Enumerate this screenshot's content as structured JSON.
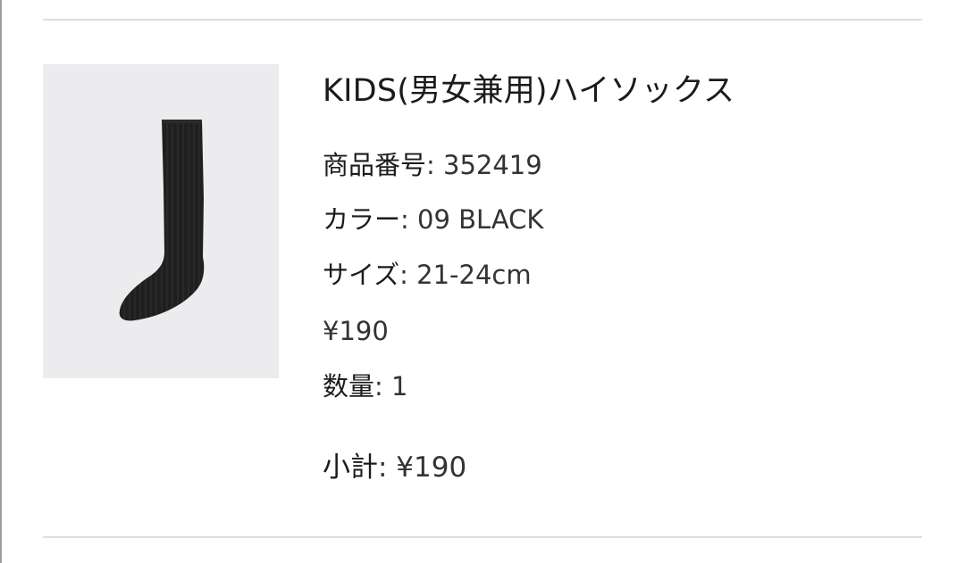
{
  "product": {
    "name": "KIDS(男女兼用)ハイソックス",
    "image_alt": "black high socks",
    "number_label": "商品番号",
    "number_value": ": 352419",
    "color_label": "カラー",
    "color_value": ": 09 BLACK",
    "size_label": "サイズ",
    "size_value": ": 21-24cm",
    "price": "¥190",
    "qty_label": "数量",
    "qty_value": ": 1",
    "subtotal_label": "小計",
    "subtotal_value": ": ¥190"
  },
  "colors": {
    "divider": "#dedede",
    "image_bg": "#ececee",
    "sock": "#1f1f1f",
    "text": "#1b1b1b"
  }
}
